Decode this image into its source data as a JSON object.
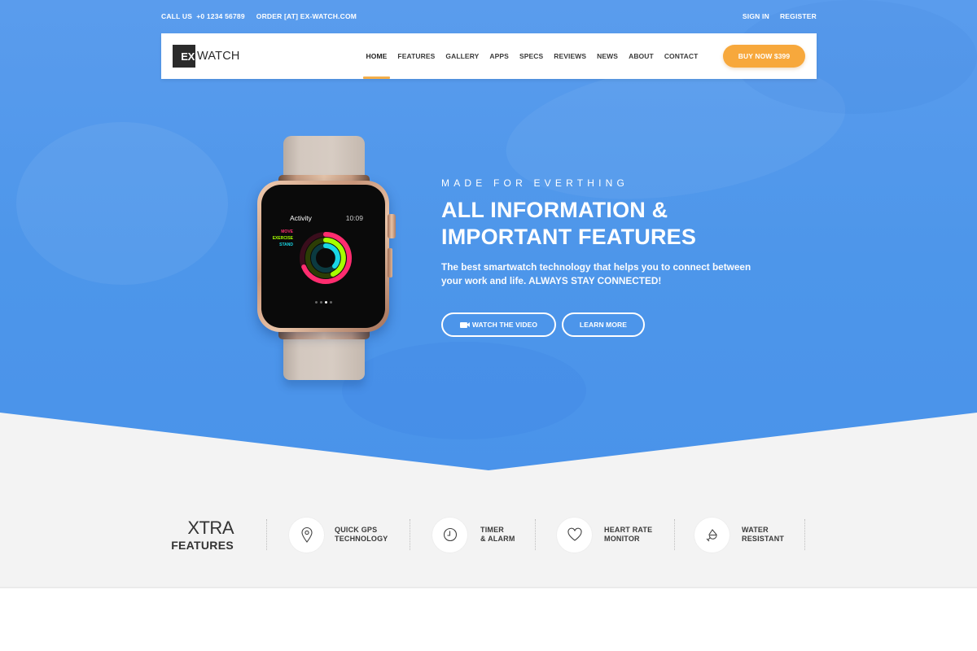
{
  "topbar": {
    "phone_label": "CALL US",
    "phone_number": "+0 1234 56789",
    "email": "ORDER [AT] EX-WATCH.COM",
    "sign_in": "SIGN IN",
    "register": "REGISTER"
  },
  "brand": {
    "logo_mark": "EX",
    "logo_text": "WATCH"
  },
  "nav": {
    "items": [
      {
        "label": "HOME",
        "active": true
      },
      {
        "label": "FEATURES",
        "active": false
      },
      {
        "label": "GALLERY",
        "active": false
      },
      {
        "label": "APPS",
        "active": false
      },
      {
        "label": "SPECS",
        "active": false
      },
      {
        "label": "REVIEWS",
        "active": false
      },
      {
        "label": "NEWS",
        "active": false
      },
      {
        "label": "ABOUT",
        "active": false
      },
      {
        "label": "CONTACT",
        "active": false
      }
    ],
    "cta": "BUY NOW $399"
  },
  "watch_screen": {
    "app_title": "Activity",
    "time": "10:09",
    "rings": [
      {
        "label": "MOVE",
        "color": "#ff2d6f"
      },
      {
        "label": "EXERCISE",
        "color": "#a6ff00"
      },
      {
        "label": "STAND",
        "color": "#19d7e6"
      }
    ],
    "page_dots": 4,
    "active_dot": 3
  },
  "hero": {
    "eyebrow": "MADE FOR EVERTHING",
    "headline_line1": "ALL INFORMATION &",
    "headline_line2": "IMPORTANT FEATURES",
    "subtitle_line1": "The best smartwatch technology that helps you to connect between",
    "subtitle_line2": "your work and life. ALWAYS STAY CONNECTED!",
    "primary_button": "WATCH THE VIDEO",
    "secondary_button": "LEARN MORE"
  },
  "features": {
    "heading_light": "XTRA",
    "heading_bold": "FEATURES",
    "items": [
      {
        "icon": "map-pin-icon",
        "line1": "QUICK GPS",
        "line2": "TECHNOLOGY"
      },
      {
        "icon": "clock-icon",
        "line1": "TIMER",
        "line2": "& ALARM"
      },
      {
        "icon": "heart-icon",
        "line1": "HEART RATE",
        "line2": "MONITOR"
      },
      {
        "icon": "water-drop-icon",
        "line1": "WATER",
        "line2": "RESISTANT"
      }
    ]
  },
  "colors": {
    "hero_blue": "#4d96ea",
    "accent_orange": "#f7a83c",
    "band_gray": "#f3f3f3",
    "text_dark": "#333333"
  }
}
